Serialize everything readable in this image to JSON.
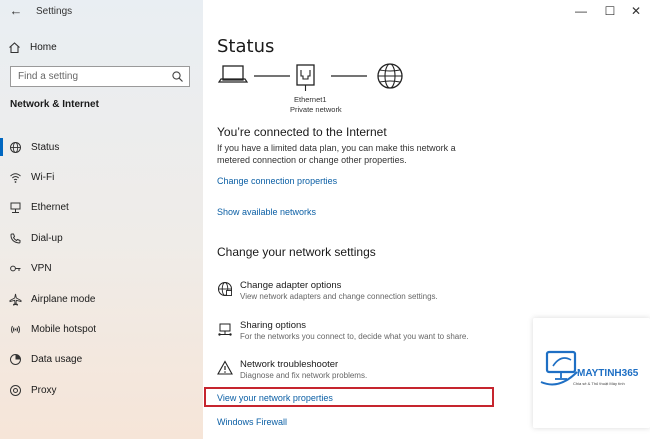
{
  "window": {
    "title": "Settings",
    "back_glyph": "←",
    "controls": [
      "—",
      "☐",
      "✕"
    ]
  },
  "sidebar": {
    "home_label": "Home",
    "search_placeholder": "Find a setting",
    "section_title": "Network & Internet",
    "selected_index": 0,
    "items": [
      {
        "label": "Status",
        "icon": "globe-icon"
      },
      {
        "label": "Wi-Fi",
        "icon": "wifi-icon"
      },
      {
        "label": "Ethernet",
        "icon": "ethernet-icon"
      },
      {
        "label": "Dial-up",
        "icon": "dialup-icon"
      },
      {
        "label": "VPN",
        "icon": "vpn-icon"
      },
      {
        "label": "Airplane mode",
        "icon": "airplane-icon"
      },
      {
        "label": "Mobile hotspot",
        "icon": "hotspot-icon"
      },
      {
        "label": "Data usage",
        "icon": "data-usage-icon"
      },
      {
        "label": "Proxy",
        "icon": "proxy-icon"
      }
    ],
    "accent_color": "#0067c0"
  },
  "main": {
    "title": "Status",
    "connection": {
      "name": "Ethernet1",
      "type": "Private network"
    },
    "connected_heading": "You’re connected to the Internet",
    "connected_desc": "If you have a limited data plan, you can make this network a metered connection or change other properties.",
    "links": {
      "change_connection": "Change connection properties",
      "show_networks": "Show available networks",
      "view_properties": "View your network properties",
      "firewall": "Windows Firewall"
    },
    "change_heading": "Change your network settings",
    "options": [
      {
        "title": "Change adapter options",
        "subtitle": "View network adapters and change connection settings.",
        "icon": "adapter-icon"
      },
      {
        "title": "Sharing options",
        "subtitle": "For the networks you connect to, decide what you want to share.",
        "icon": "sharing-icon"
      },
      {
        "title": "Network troubleshooter",
        "subtitle": "Diagnose and fix network problems.",
        "icon": "warning-icon"
      }
    ],
    "link_color": "#0b5fa5",
    "highlight_color": "#c6252e"
  },
  "watermark": {
    "brand": "MAYTINH365",
    "tagline": "Chia sẻ & Thủ thuật Máy tính"
  }
}
